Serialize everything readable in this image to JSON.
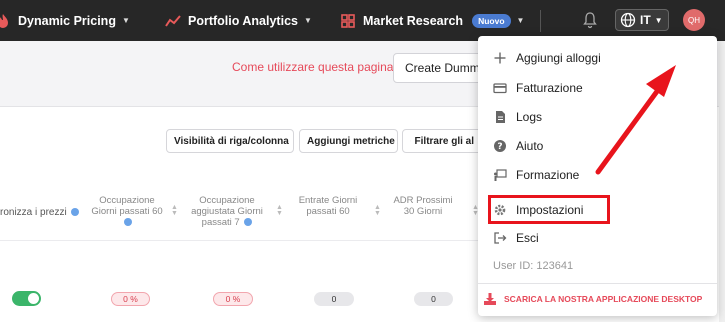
{
  "nav": {
    "dynamic_pricing": "Dynamic Pricing",
    "portfolio_analytics": "Portfolio Analytics",
    "market_research": "Market Research",
    "new_badge": "Nuovo",
    "language": "IT",
    "avatar_initials": "QH"
  },
  "page": {
    "help_link": "Come utilizzare questa pagina?",
    "create_button": "Create Dummy"
  },
  "toolbar": {
    "visibility": "Visibilità di riga/colonna",
    "add_metrics": "Aggiungi metriche",
    "filter": "Filtrare gli al"
  },
  "table": {
    "headers": {
      "sync": "ronizza i prezzi",
      "occ60": "Occupazione Giorni passati 60",
      "occadj": "Occupazione aggiustata Giorni passati 7",
      "rev60": "Entrate Giorni passati 60",
      "adr30": "ADR Prossimi 30 Giorni"
    },
    "row": {
      "occ60": "0 %",
      "occadj": "0 %",
      "rev60": "0",
      "adr30": "0"
    }
  },
  "menu": {
    "add_listings": "Aggiungi alloggi",
    "billing": "Fatturazione",
    "logs": "Logs",
    "help": "Aiuto",
    "training": "Formazione",
    "settings": "Impostazioni",
    "exit": "Esci",
    "user_id": "User ID: 123641",
    "download_app": "SCARICA LA NOSTRA APPLICAZIONE DESKTOP"
  },
  "colors": {
    "topbar": "#272727",
    "accent_red": "#e64a5a",
    "annotation_red": "#e8141c",
    "toggle_green": "#3bb56a",
    "badge_blue": "#4a7bd1"
  }
}
